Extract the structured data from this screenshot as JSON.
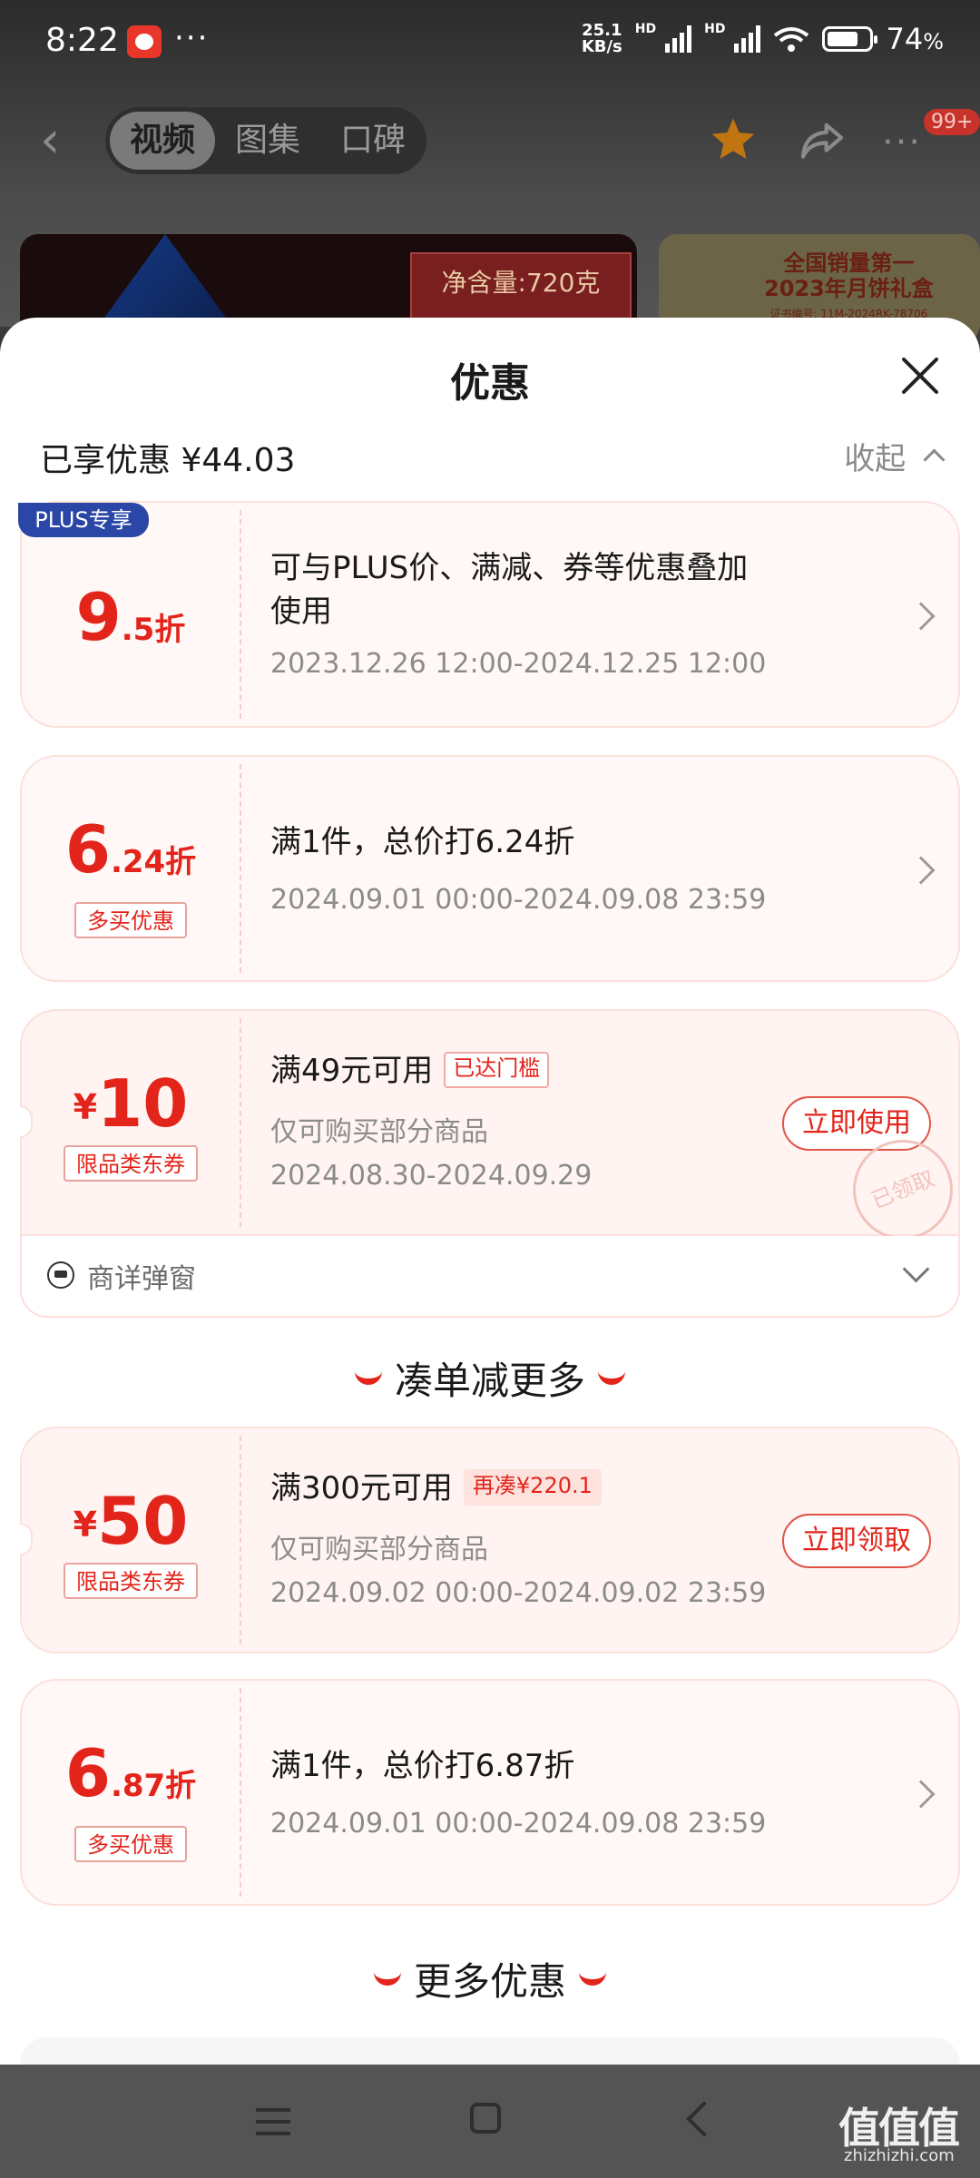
{
  "status_bar": {
    "time": "8:22",
    "dots": "···",
    "net_speed_value": "25.1",
    "net_speed_unit": "KB/s",
    "hd1": "HD",
    "hd2": "HD",
    "wifi_label": "6",
    "battery_pct": "74",
    "battery_unit": "%",
    "battery_level": 0.74
  },
  "header": {
    "tabs": [
      {
        "label": "视频",
        "active": true
      },
      {
        "label": "图集",
        "active": false
      },
      {
        "label": "口碑",
        "active": false
      }
    ],
    "badge": "99+",
    "star_color": "#c07510"
  },
  "banner": {
    "weight_text": "净含量:720克",
    "right_text_line1": "全国销量第一",
    "right_text_line2": "2023年月饼礼盒",
    "right_text_line3": "证书编号: 11M-2024RK-78706"
  },
  "sheet": {
    "title": "优惠",
    "enjoyed": "已享优惠 ¥44.03",
    "collapse": "收起",
    "plus_badge": "PLUS专享",
    "cards": [
      {
        "value_big": "9",
        "value_small": ".5折",
        "desc_line1": "可与PLUS价、满减、券等优惠叠加",
        "desc_line2": "使用",
        "date": "2023.12.26 12:00-2024.12.25 12:00"
      },
      {
        "value_big": "6",
        "value_small": ".24折",
        "tag": "多买优惠",
        "desc_line1": "满1件，总价打6.24折",
        "date": "2024.09.01 00:00-2024.09.08 23:59"
      },
      {
        "yen": "¥",
        "value_big": "10",
        "tag": "限品类东券",
        "desc_line1": "满49元可用",
        "chip": "已达门槛",
        "scope": "仅可购买部分商品",
        "date": "2024.08.30-2024.09.29",
        "action": "立即使用",
        "stamp": "已领取"
      },
      {
        "yen": "¥",
        "value_big": "50",
        "tag": "限品类东券",
        "desc_line1": "满300元可用",
        "chip": "再凑¥220.1",
        "scope": "仅可购买部分商品",
        "date": "2024.09.02 00:00-2024.09.02 23:59",
        "action": "立即领取"
      },
      {
        "value_big": "6",
        "value_small": ".87折",
        "tag": "多买优惠",
        "desc_line1": "满1件，总价打6.87折",
        "date": "2024.09.01 00:00-2024.09.08 23:59"
      }
    ],
    "sub_panel": "商详弹窗",
    "section1": "凑单减更多",
    "section2": "更多优惠"
  },
  "watermark": {
    "main": "值值值",
    "sub": "zhizhizhi.com"
  },
  "colors": {
    "accent": "#e3241a",
    "plus_blue": "#2a46a6",
    "card_bg": "#fff8f6"
  }
}
